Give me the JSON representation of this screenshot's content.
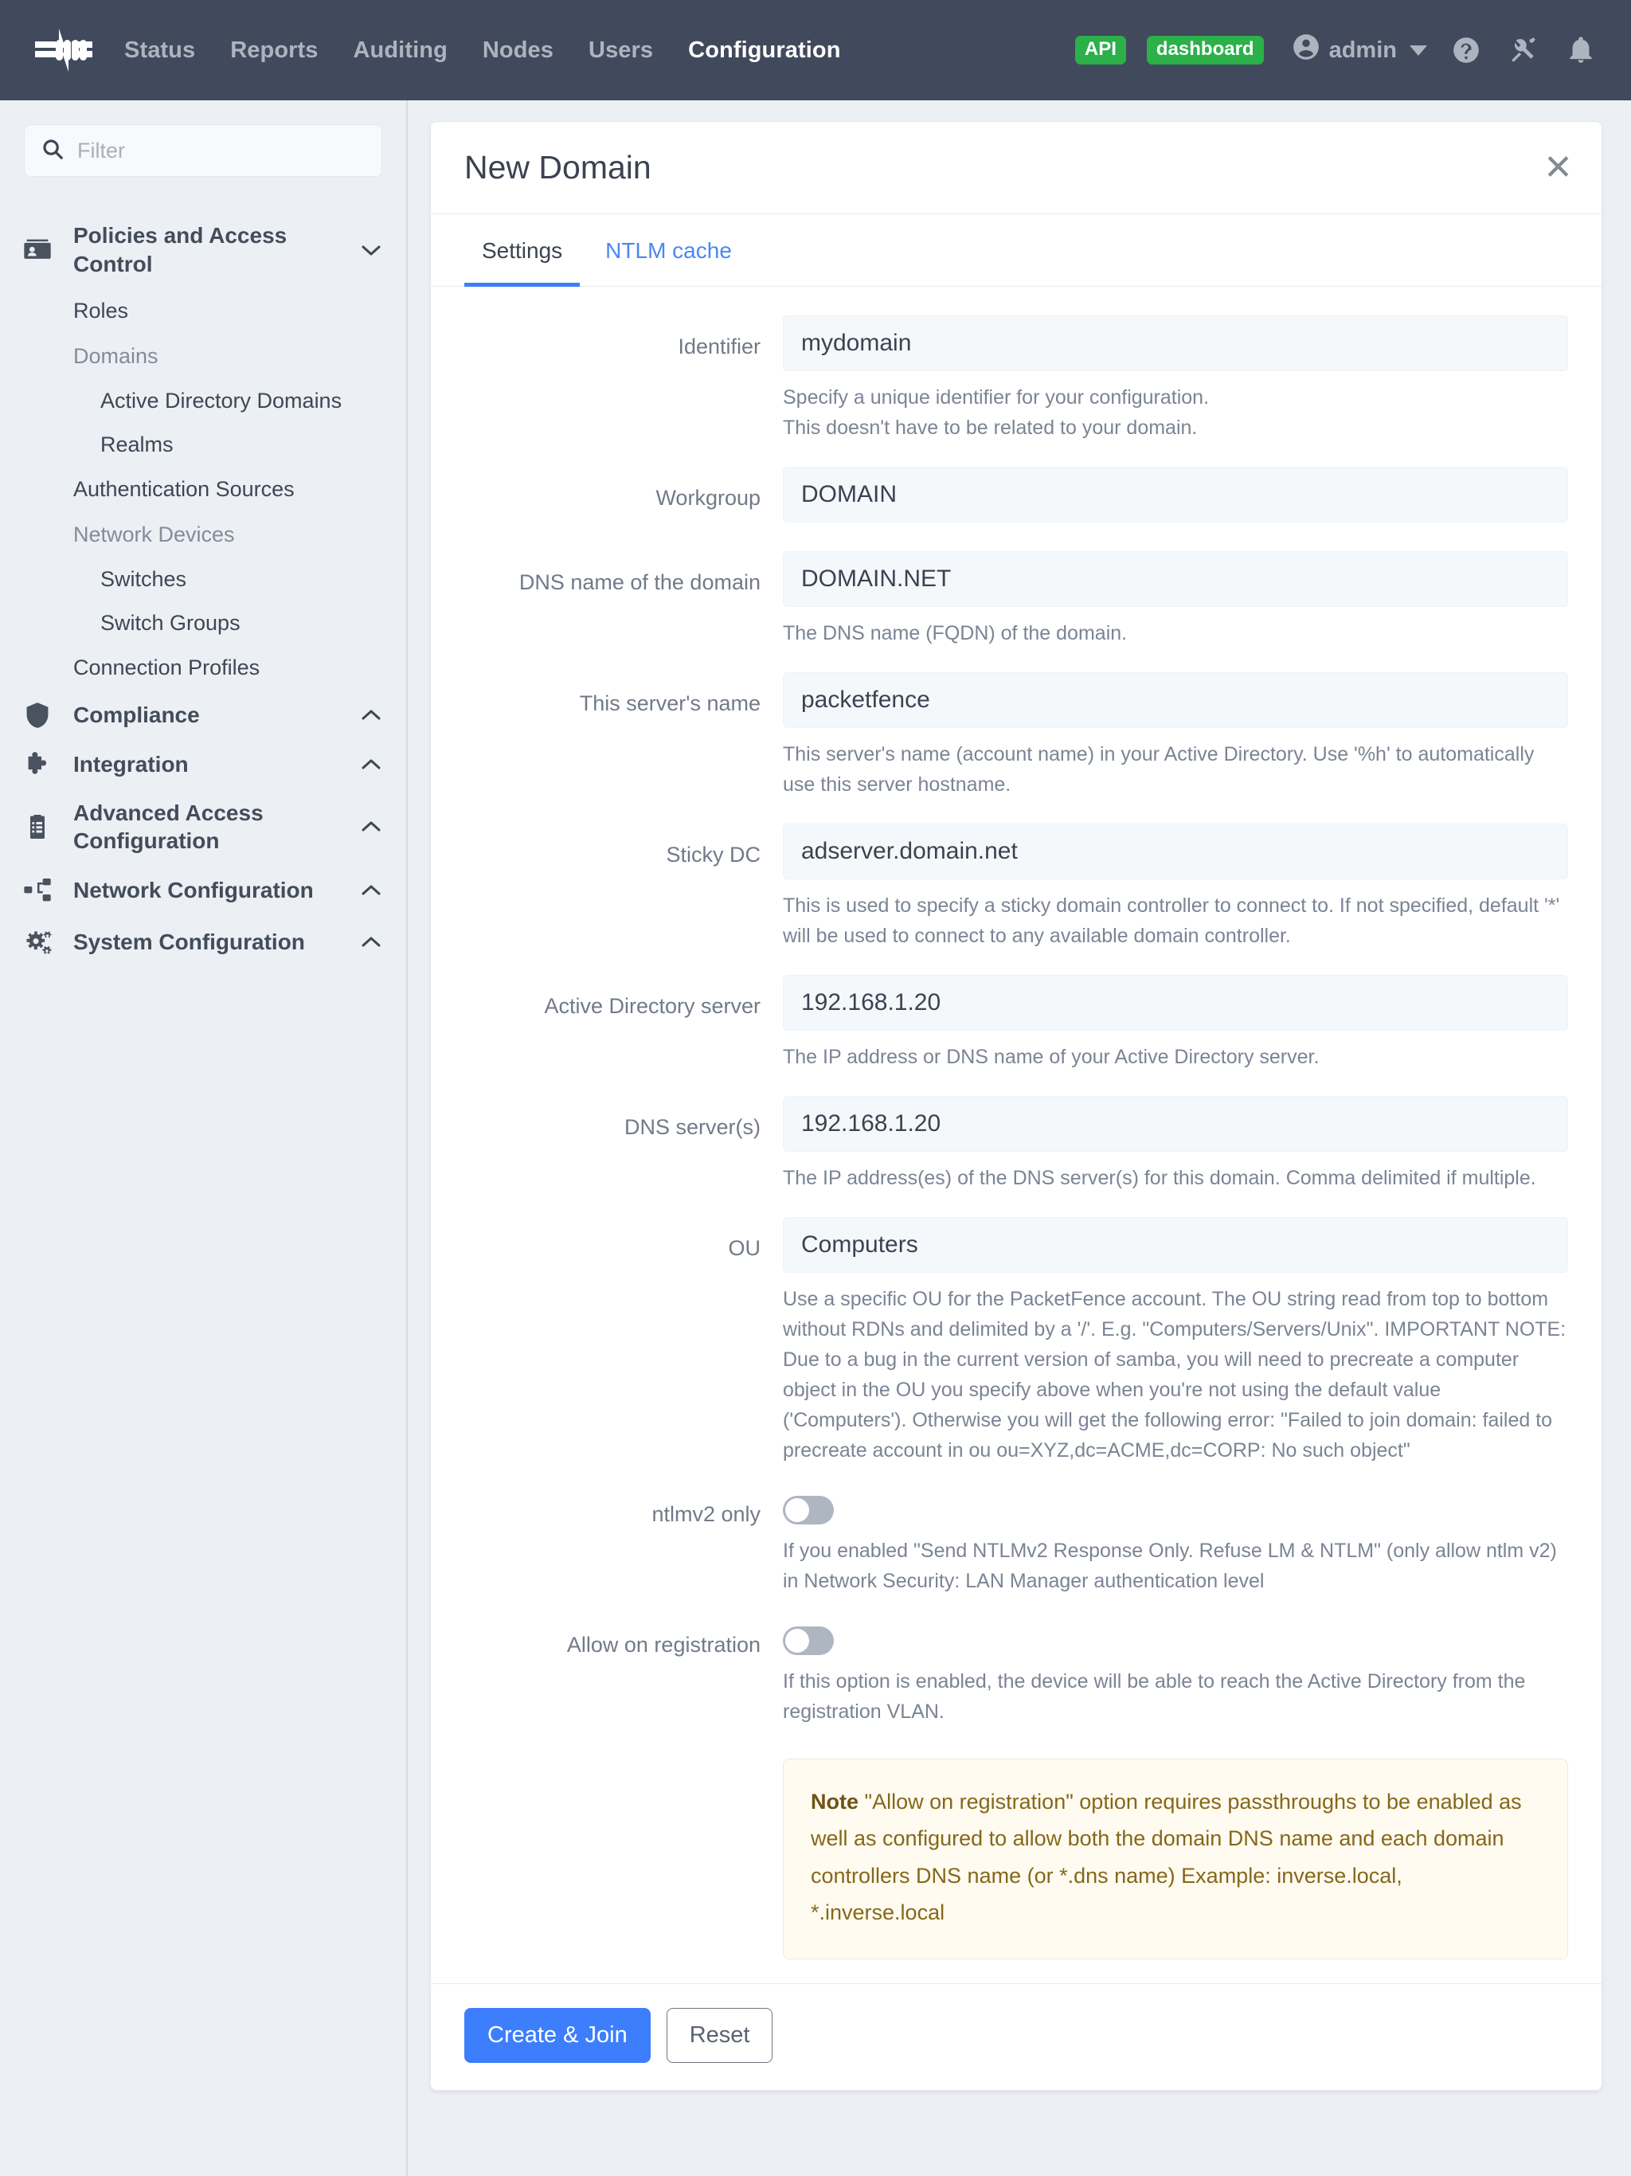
{
  "topnav": {
    "logo_name": "packetfence-logo",
    "links": [
      {
        "label": "Status",
        "active": false
      },
      {
        "label": "Reports",
        "active": false
      },
      {
        "label": "Auditing",
        "active": false
      },
      {
        "label": "Nodes",
        "active": false
      },
      {
        "label": "Users",
        "active": false
      },
      {
        "label": "Configuration",
        "active": true
      }
    ],
    "badges": [
      {
        "label": "API",
        "color": "#2bb04a"
      },
      {
        "label": "dashboard",
        "color": "#2bb04a"
      }
    ],
    "user": "admin",
    "icons": [
      "help-icon",
      "tools-icon",
      "bell-icon"
    ]
  },
  "sidebar": {
    "filter_placeholder": "Filter",
    "filter_value": "",
    "groups": [
      {
        "label": "Policies and Access Control",
        "icon": "id-card-icon",
        "expanded": true,
        "chevron": "chevron-down-icon",
        "items": [
          {
            "type": "item",
            "label": "Roles"
          },
          {
            "type": "subhead",
            "label": "Domains"
          },
          {
            "type": "subitem",
            "label": "Active Directory Domains"
          },
          {
            "type": "subitem",
            "label": "Realms"
          },
          {
            "type": "item",
            "label": "Authentication Sources"
          },
          {
            "type": "subhead",
            "label": "Network Devices"
          },
          {
            "type": "subitem",
            "label": "Switches"
          },
          {
            "type": "subitem",
            "label": "Switch Groups"
          },
          {
            "type": "item",
            "label": "Connection Profiles"
          }
        ]
      },
      {
        "label": "Compliance",
        "icon": "shield-icon",
        "expanded": false,
        "chevron": "chevron-up-icon",
        "items": []
      },
      {
        "label": "Integration",
        "icon": "puzzle-icon",
        "expanded": false,
        "chevron": "chevron-up-icon",
        "items": []
      },
      {
        "label": "Advanced Access Configuration",
        "icon": "clipboard-icon",
        "expanded": false,
        "chevron": "chevron-up-icon",
        "items": []
      },
      {
        "label": "Network Configuration",
        "icon": "network-icon",
        "expanded": false,
        "chevron": "chevron-up-icon",
        "items": []
      },
      {
        "label": "System Configuration",
        "icon": "gears-icon",
        "expanded": false,
        "chevron": "chevron-up-icon",
        "items": []
      }
    ]
  },
  "panel": {
    "title": "New Domain",
    "close_label": "✕",
    "tabs": [
      {
        "label": "Settings",
        "active": true
      },
      {
        "label": "NTLM cache",
        "active": false
      }
    ]
  },
  "form": {
    "fields": [
      {
        "name": "identifier",
        "label": "Identifier",
        "value": "mydomain",
        "placeholder": "",
        "help": "Specify a unique identifier for your configuration.\nThis doesn't have to be related to your domain."
      },
      {
        "name": "workgroup",
        "label": "Workgroup",
        "value": "DOMAIN",
        "placeholder": "",
        "help": ""
      },
      {
        "name": "dns-name-of-the-domain",
        "label": "DNS name of the domain",
        "value": "DOMAIN.NET",
        "placeholder": "",
        "help": "The DNS name (FQDN) of the domain."
      },
      {
        "name": "this-servers-name",
        "label": "This server's name",
        "value": "packetfence",
        "placeholder": "",
        "help": "This server's name (account name) in your Active Directory. Use '%h' to automatically use this server hostname."
      },
      {
        "name": "sticky-dc",
        "label": "Sticky DC",
        "value": "adserver.domain.net",
        "placeholder": "",
        "help": "This is used to specify a sticky domain controller to connect to. If not specified, default '*' will be used to connect to any available domain controller."
      },
      {
        "name": "active-directory-server",
        "label": "Active Directory server",
        "value": "192.168.1.20",
        "placeholder": "",
        "help": "The IP address or DNS name of your Active Directory server."
      },
      {
        "name": "dns-servers",
        "label": "DNS server(s)",
        "value": "192.168.1.20",
        "placeholder": "",
        "help": "The IP address(es) of the DNS server(s) for this domain. Comma delimited if multiple."
      },
      {
        "name": "ou",
        "label": "OU",
        "value": "Computers",
        "placeholder": "",
        "help": "Use a specific OU for the PacketFence account. The OU string read from top to bottom without RDNs and delimited by a '/'. E.g. \"Computers/Servers/Unix\". IMPORTANT NOTE: Due to a bug in the current version of samba, you will need to precreate a computer object in the OU you specify above when you're not using the default value ('Computers'). Otherwise you will get the following error: \"Failed to join domain: failed to precreate account in ou ou=XYZ,dc=ACME,dc=CORP: No such object\""
      }
    ],
    "toggles": [
      {
        "name": "ntlmv2-only",
        "label": "ntlmv2 only",
        "on": false,
        "help": "If you enabled \"Send NTLMv2 Response Only. Refuse LM & NTLM\" (only allow ntlm v2) in Network Security: LAN Manager authentication level"
      },
      {
        "name": "allow-on-registration",
        "label": "Allow on registration",
        "on": false,
        "help": "If this option is enabled, the device will be able to reach the Active Directory from the registration VLAN."
      }
    ],
    "note": {
      "title": "Note",
      "text": " \"Allow on registration\" option requires passthroughs to be enabled as well as configured to allow both the domain DNS name and each domain controllers DNS name (or *.dns name) Example: inverse.local, *.inverse.local"
    }
  },
  "footer": {
    "primary_label": "Create & Join",
    "secondary_label": "Reset"
  },
  "colors": {
    "nav_bg": "#414a5c",
    "page_bg": "#eceff4",
    "accent_blue": "#3d7efc",
    "badge_green": "#2bb04a",
    "note_bg": "#fffbf0",
    "note_text": "#86671a"
  }
}
